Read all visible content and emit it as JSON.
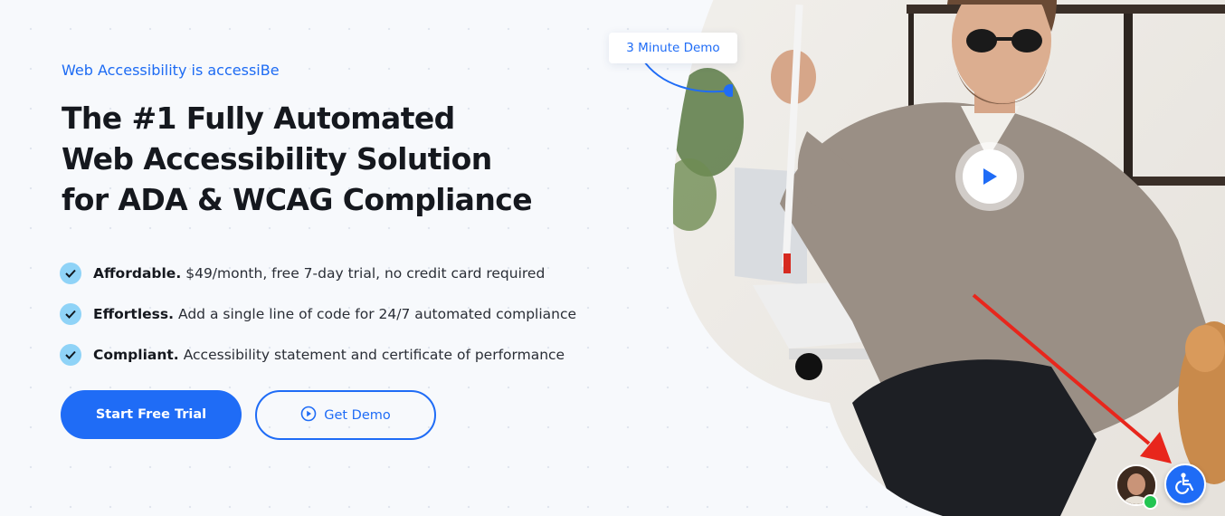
{
  "hero": {
    "eyebrow": "Web Accessibility is accessiBe",
    "headline": [
      "The #1 Fully Automated",
      "Web Accessibility Solution",
      "for ADA & WCAG Compliance"
    ],
    "features": [
      {
        "title": "Affordable.",
        "text": "$49/month, free 7-day trial, no credit card required"
      },
      {
        "title": "Effortless.",
        "text": "Add a single line of code for 24/7 automated compliance"
      },
      {
        "title": "Compliant.",
        "text": "Accessibility statement and certificate of performance"
      }
    ],
    "primary_button": "Start Free Trial",
    "secondary_button": "Get Demo"
  },
  "media": {
    "demo_tag": "3 Minute Demo",
    "play_icon": "play-icon"
  },
  "widgets": {
    "chat_avatar": "chat-avatar",
    "accessibility_icon": "wheelchair-icon"
  },
  "colors": {
    "brand": "#1f6cf6",
    "check": "#8fd3f7",
    "annotation_arrow": "#e8261c",
    "online": "#23c552"
  }
}
